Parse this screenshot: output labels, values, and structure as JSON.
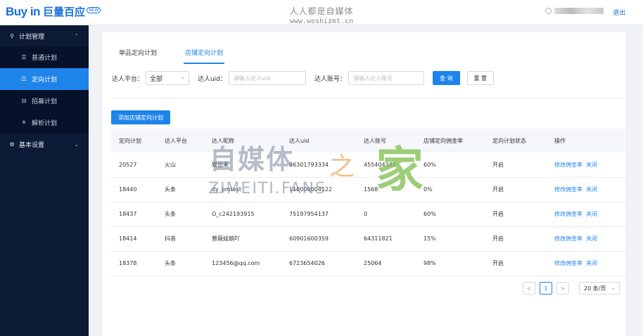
{
  "header": {
    "logo_text": "Buy in",
    "logo_sub": "巨量百应",
    "logo_tag": "NEW",
    "watermark_line1": "人人都是自媒体",
    "watermark_line2": "www.woshizmt.cn",
    "logout_label": "退出",
    "user_icon": "user-icon"
  },
  "sidebar": {
    "group1": {
      "label": "计划管理",
      "icon": "plan-icon"
    },
    "items": [
      {
        "label": "普通计划",
        "icon": "list-icon"
      },
      {
        "label": "定向计划",
        "icon": "target-icon",
        "active": true
      },
      {
        "label": "招募计划",
        "icon": "recruit-icon"
      },
      {
        "label": "解析计划",
        "icon": "analyze-icon"
      }
    ],
    "group2": {
      "label": "基本设置",
      "icon": "gear-icon"
    }
  },
  "tabs": [
    {
      "label": "单品定向计划"
    },
    {
      "label": "店铺定向计划",
      "active": true
    }
  ],
  "filters": {
    "platform_label": "达人平台：",
    "platform_value": "全部",
    "uid_label": "达人uid：",
    "uid_placeholder": "请输入达人uid",
    "account_label": "达人账号：",
    "account_placeholder": "请输入达人账号",
    "search_label": "查 询",
    "reset_label": "重 置"
  },
  "add_button_label": "添加店铺定向计划",
  "table": {
    "columns": [
      "定向计划",
      "达人平台",
      "达人昵称",
      "达人uid",
      "达人账号",
      "店铺定向佣金率",
      "定向计划状态",
      "操作"
    ],
    "rows": [
      {
        "plan": "20527",
        "platform": "火山",
        "nickname": "致出来",
        "uid": "86301793334",
        "account": "455404343",
        "rate": "60%",
        "status": "开启"
      },
      {
        "plan": "18440",
        "platform": "头条",
        "nickname": "dy_pmtest",
        "uid": "110000004122",
        "account": "1568",
        "rate": "0%",
        "status": "开启"
      },
      {
        "plan": "18437",
        "platform": "头条",
        "nickname": "O_c242193915",
        "uid": "75197954137",
        "account": "0",
        "rate": "60%",
        "status": "开启"
      },
      {
        "plan": "18414",
        "platform": "抖音",
        "nickname": "曾薇娃娘吖",
        "uid": "60901600359",
        "account": "64311821",
        "rate": "15%",
        "status": "开启"
      },
      {
        "plan": "18378",
        "platform": "头条",
        "nickname": "123456@qq.com",
        "uid": "6723654026",
        "account": "25064",
        "rate": "98%",
        "status": "开启"
      }
    ],
    "action_modify": "修改佣金率",
    "action_close": "关闭"
  },
  "pagination": {
    "prev": "<",
    "current": "1",
    "next": ">",
    "page_size": "20 条/页"
  },
  "watermark": {
    "big": "自媒体",
    "zhi": "之",
    "jia": "家",
    "fans": "ZIMEITI.FANS"
  }
}
